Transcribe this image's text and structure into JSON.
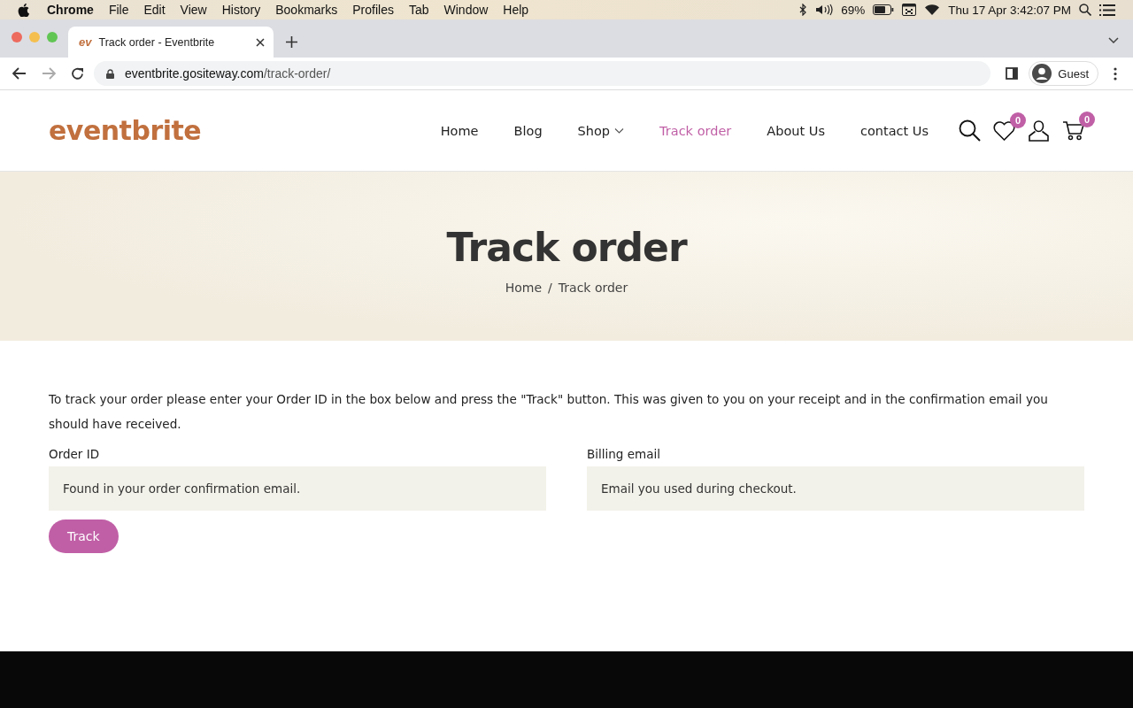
{
  "menubar": {
    "app": "Chrome",
    "menus": [
      "File",
      "Edit",
      "View",
      "History",
      "Bookmarks",
      "Profiles",
      "Tab",
      "Window",
      "Help"
    ],
    "battery": "69%",
    "clock": "Thu 17 Apr  3:42:07 PM"
  },
  "browser": {
    "tab_favicon": "ev",
    "tab_title": "Track order - Eventbrite",
    "url_host": "eventbrite.gositeway.com",
    "url_path": "/track-order/",
    "profile": "Guest"
  },
  "site": {
    "logo": "eventbrite",
    "nav": [
      {
        "label": "Home",
        "selected": false,
        "dropdown": false
      },
      {
        "label": "Blog",
        "selected": false,
        "dropdown": false
      },
      {
        "label": "Shop",
        "selected": false,
        "dropdown": true
      },
      {
        "label": "Track order",
        "selected": true,
        "dropdown": false
      },
      {
        "label": "About Us",
        "selected": false,
        "dropdown": false
      },
      {
        "label": "contact Us",
        "selected": false,
        "dropdown": false
      }
    ],
    "wishlist_count": "0",
    "cart_count": "0"
  },
  "hero": {
    "title": "Track order",
    "breadcrumb": [
      "Home",
      "Track order"
    ],
    "separator": "/"
  },
  "form": {
    "intro": "To track your order please enter your Order ID in the box below and press the \"Track\" button. This was given to you on your receipt and in the confirmation email you should have received.",
    "fields": [
      {
        "label": "Order ID",
        "placeholder": "Found in your order confirmation email."
      },
      {
        "label": "Billing email",
        "placeholder": "Email you used during checkout."
      }
    ],
    "button": "Track"
  }
}
